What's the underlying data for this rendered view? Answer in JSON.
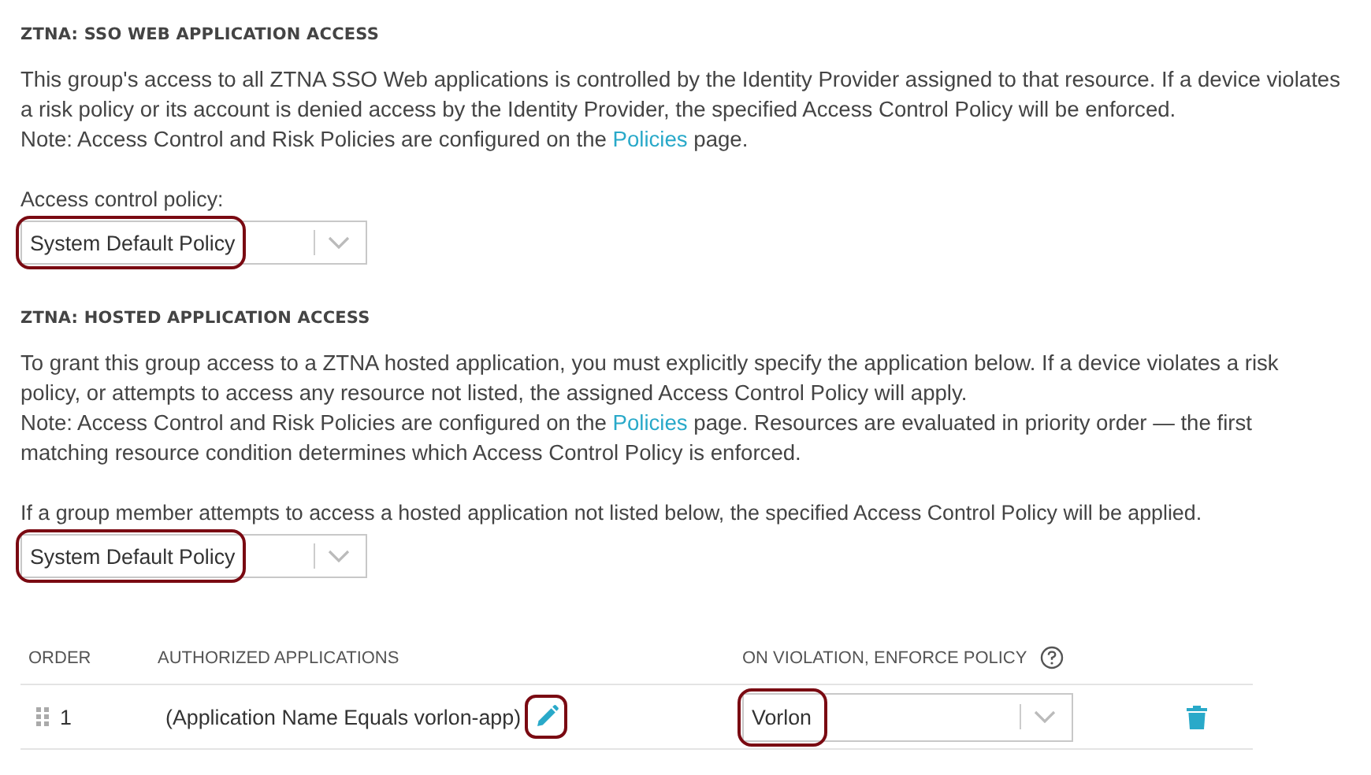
{
  "sso_section": {
    "heading": "ZTNA: SSO WEB APPLICATION ACCESS",
    "description": "This group's access to all ZTNA SSO Web applications is controlled by the Identity Provider assigned to that resource. If a device violates a risk policy or its account is denied access by the Identity Provider, the specified Access Control Policy will be enforced.",
    "note": {
      "before": "Note: Access Control and Risk Policies are configured on the ",
      "link": "Policies",
      "after": " page."
    },
    "field_label": "Access control policy:",
    "select": {
      "value": "System Default Policy",
      "highlighted": true
    }
  },
  "hosted_section": {
    "heading": "ZTNA: HOSTED APPLICATION ACCESS",
    "description": "To grant this group access to a ZTNA hosted application, you must explicitly specify the application below. If a device violates a risk policy, or attempts to access any resource not listed, the assigned Access Control Policy will apply.",
    "note": {
      "before": "Note: Access Control and Risk Policies are configured on the ",
      "link": "Policies",
      "after": " page. Resources are evaluated in priority order — the first matching resource condition determines which Access Control Policy is enforced."
    },
    "field_label": "If a group member attempts to access a hosted application not listed below, the specified Access Control Policy will be applied.",
    "select": {
      "value": "System Default Policy",
      "highlighted": true
    },
    "table": {
      "columns": [
        {
          "label": "ORDER",
          "help": false
        },
        {
          "label": "AUTHORIZED APPLICATIONS",
          "help": false
        },
        {
          "label": "ON VIOLATION, ENFORCE POLICY",
          "help": true
        }
      ],
      "rows": [
        {
          "order": "1",
          "application": "(Application Name Equals vorlon-app)",
          "edit_highlighted": true,
          "policy": "Vorlon",
          "policy_highlighted": true
        }
      ]
    }
  }
}
